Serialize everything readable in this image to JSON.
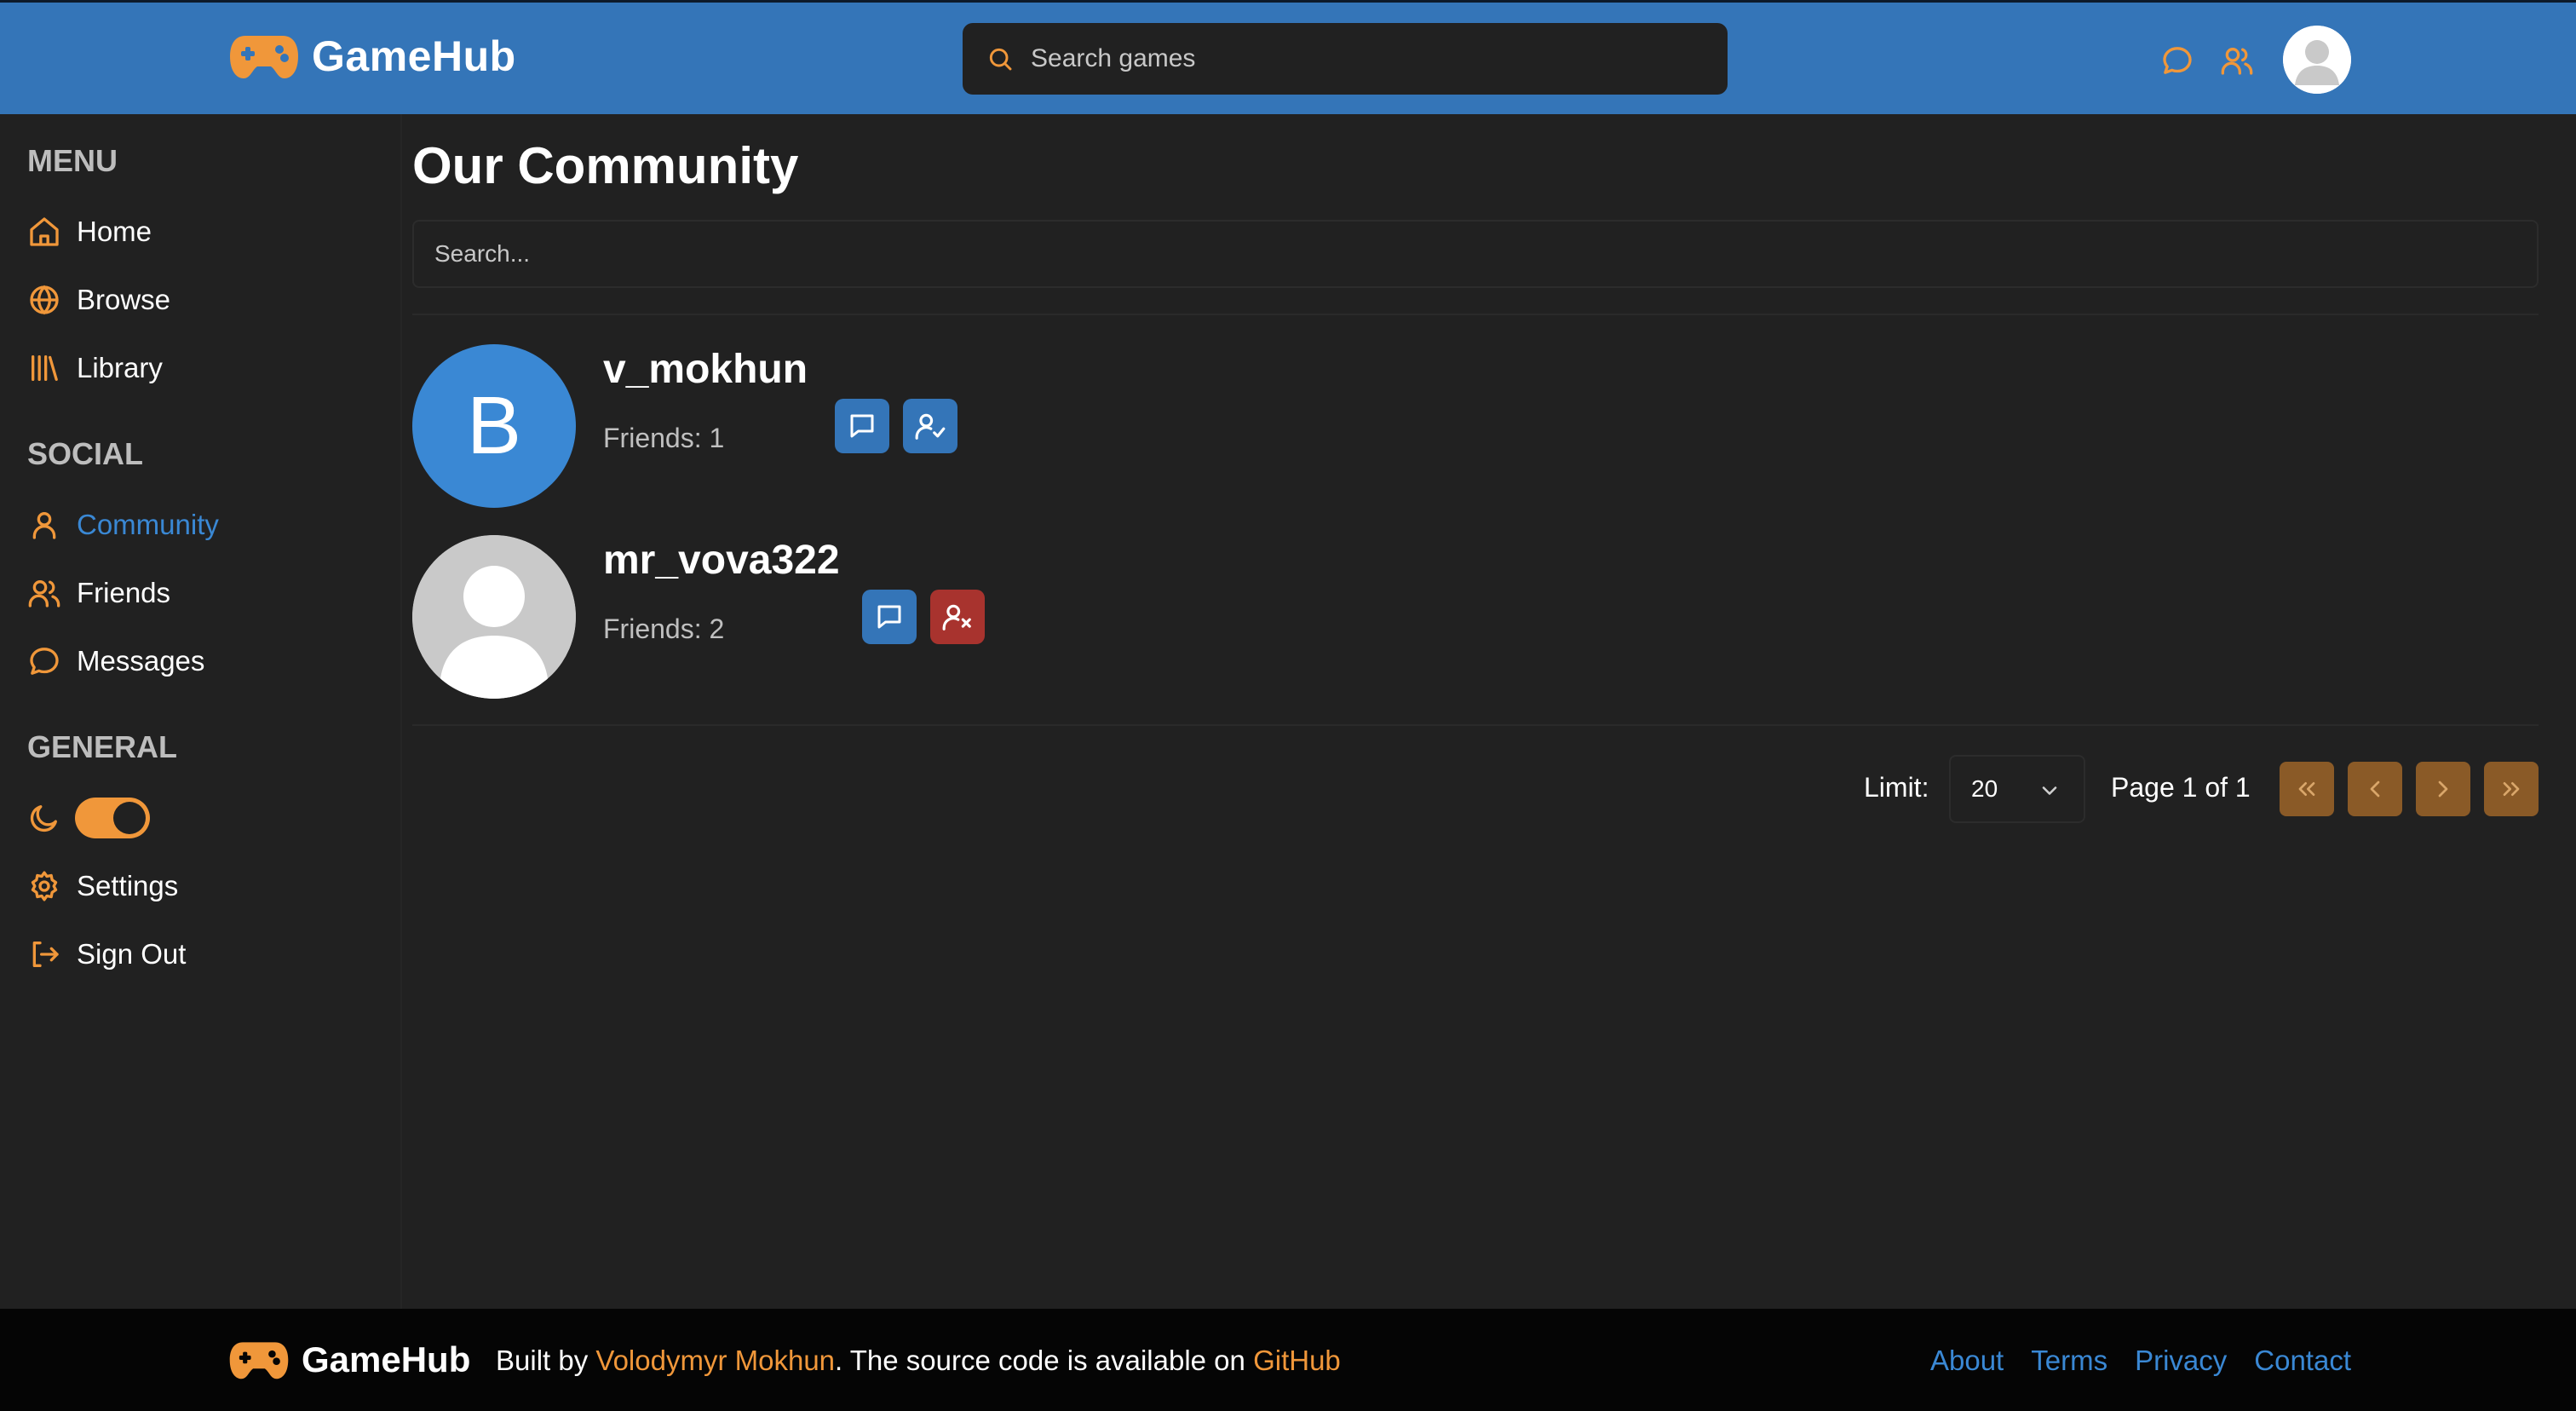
{
  "header": {
    "brand": "GameHub",
    "search_placeholder": "Search games",
    "icons": [
      "gamepad-icon",
      "search-icon",
      "messages-icon",
      "friends-icon",
      "avatar"
    ]
  },
  "sidebar": {
    "menu_title": "MENU",
    "menu_items": [
      {
        "label": "Home",
        "icon": "home-icon"
      },
      {
        "label": "Browse",
        "icon": "globe-icon"
      },
      {
        "label": "Library",
        "icon": "library-icon"
      }
    ],
    "social_title": "SOCIAL",
    "social_items": [
      {
        "label": "Community",
        "icon": "user-icon",
        "active": true
      },
      {
        "label": "Friends",
        "icon": "users-icon"
      },
      {
        "label": "Messages",
        "icon": "message-icon"
      }
    ],
    "general_title": "GENERAL",
    "theme_toggle": {
      "icon": "moon-icon",
      "dark_mode": true
    },
    "general_items": [
      {
        "label": "Settings",
        "icon": "gear-icon"
      },
      {
        "label": "Sign Out",
        "icon": "sign-out-icon"
      }
    ]
  },
  "main": {
    "title": "Our Community",
    "search_placeholder": "Search...",
    "users": [
      {
        "username": "v_mokhun",
        "friends": "Friends: 1",
        "avatar_letter": "B",
        "actions": [
          "message",
          "friend-added"
        ]
      },
      {
        "username": "mr_vova322",
        "friends": "Friends: 2",
        "avatar_letter": "",
        "actions": [
          "message",
          "remove-friend"
        ]
      }
    ],
    "pagination": {
      "limit_label": "Limit:",
      "limit_value": "20",
      "page_info": "Page 1 of 1"
    }
  },
  "footer": {
    "brand": "GameHub",
    "built_by": "Built by ",
    "author": "Volodymyr Mokhun",
    "middle": ". The source code is available on ",
    "github": "GitHub",
    "links": [
      "About",
      "Terms",
      "Privacy",
      "Contact"
    ]
  },
  "colors": {
    "accent_orange": "#f0973a",
    "header_blue": "#3475b8",
    "link_blue": "#3a88d4",
    "danger_red": "#a8332e",
    "background": "#212121"
  }
}
